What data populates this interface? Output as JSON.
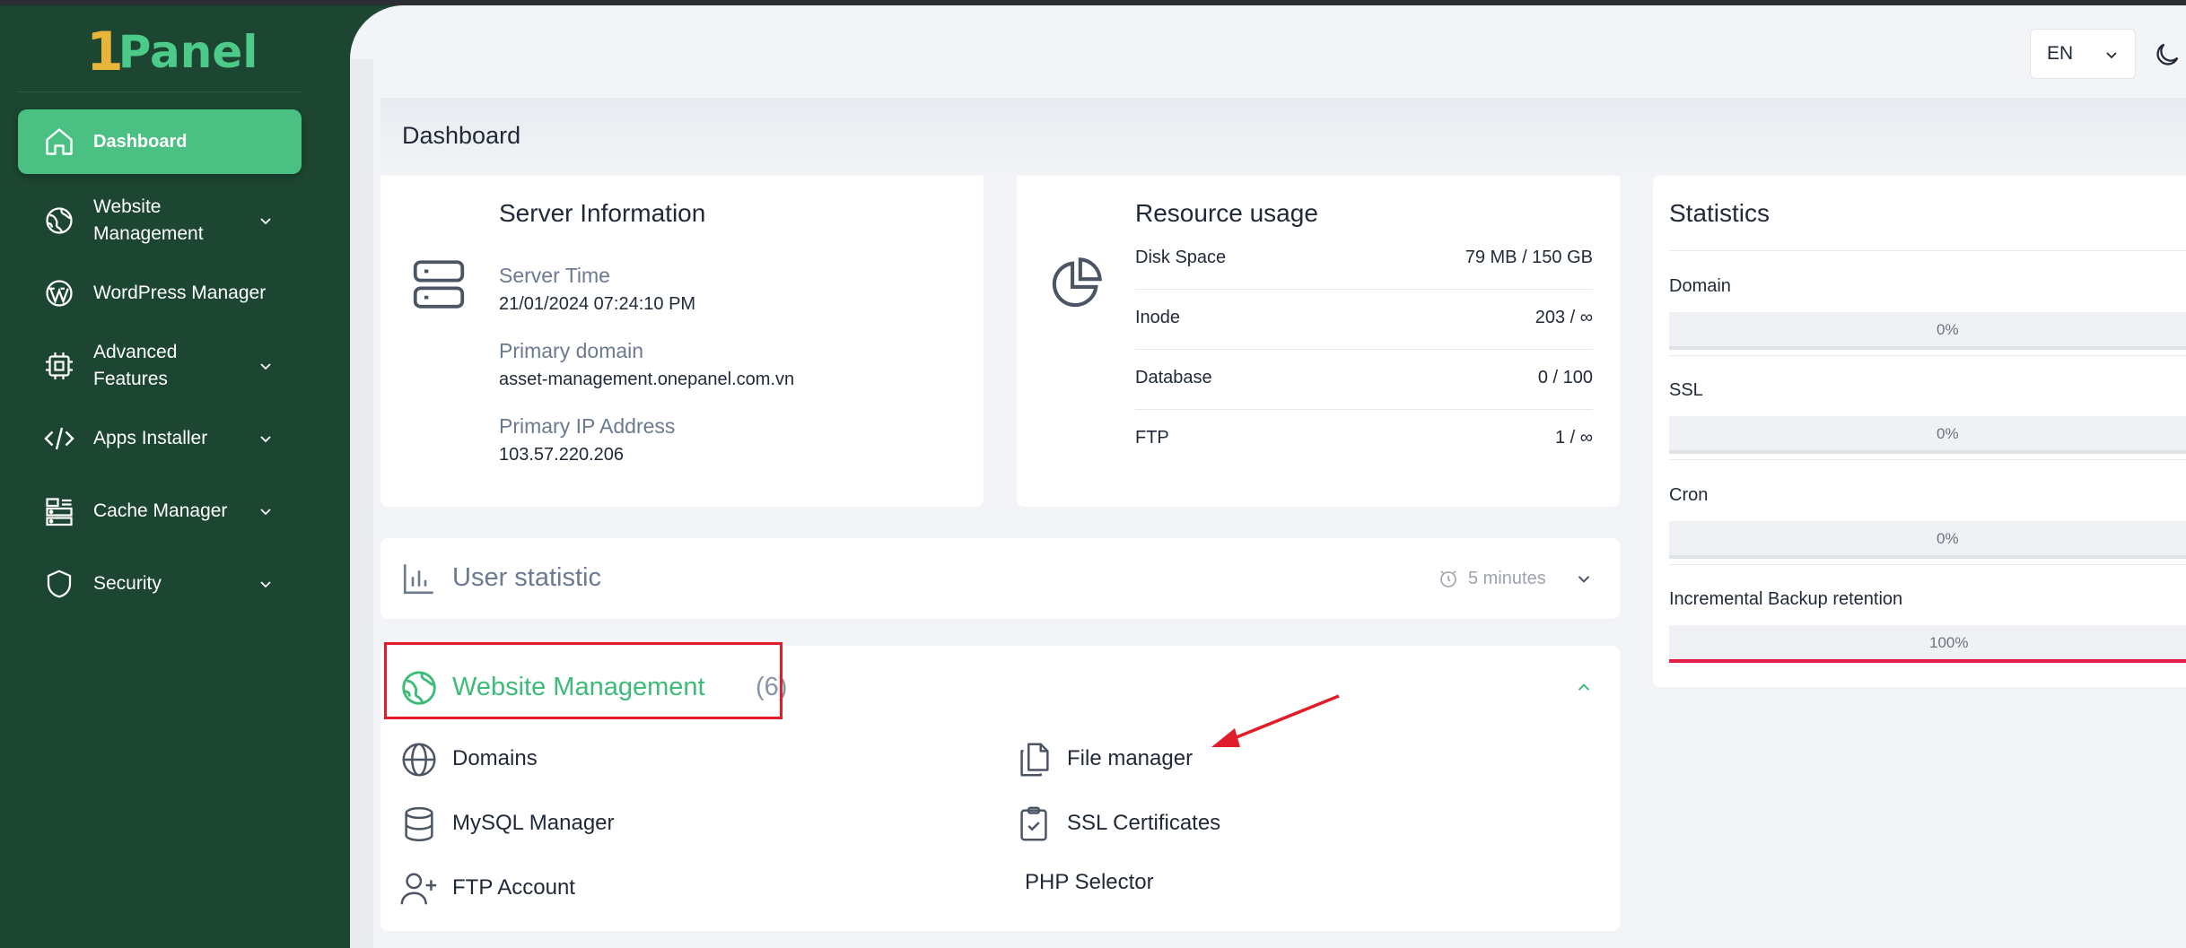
{
  "sidebar": {
    "logo": {
      "one": "1",
      "text": "Panel"
    },
    "items": [
      {
        "label": "Dashboard",
        "icon": "home-icon"
      },
      {
        "label": "Website\nManagement",
        "icon": "globe-network-icon"
      },
      {
        "label": "WordPress Manager",
        "icon": "wordpress-icon"
      },
      {
        "label": "Advanced\nFeatures",
        "icon": "chip-icon"
      },
      {
        "label": "Apps Installer",
        "icon": "code-icon"
      },
      {
        "label": "Cache Manager",
        "icon": "server-stack-icon"
      },
      {
        "label": "Security",
        "icon": "shield-icon"
      }
    ]
  },
  "header": {
    "language": "EN",
    "page_title": "Dashboard"
  },
  "server_info": {
    "title": "Server Information",
    "server_time_label": "Server Time",
    "server_time": "21/01/2024 07:24:10 PM",
    "primary_domain_label": "Primary domain",
    "primary_domain": "asset-management.onepanel.com.vn",
    "primary_ip_label": "Primary IP Address",
    "primary_ip": "103.57.220.206"
  },
  "resource_usage": {
    "title": "Resource usage",
    "rows": [
      {
        "label": "Disk Space",
        "value": "79 MB / 150 GB"
      },
      {
        "label": "Inode",
        "value": "203 / ∞"
      },
      {
        "label": "Database",
        "value": "0 / 100"
      },
      {
        "label": "FTP",
        "value": "1 / ∞"
      }
    ]
  },
  "statistics": {
    "title": "Statistics",
    "items": [
      {
        "label": "Domain",
        "percent": "0%"
      },
      {
        "label": "SSL",
        "percent": "0%"
      },
      {
        "label": "Cron",
        "percent": "0%"
      },
      {
        "label": "Incremental Backup retention",
        "percent": "100%"
      }
    ]
  },
  "user_statistic": {
    "title": "User statistic",
    "interval": "5 minutes"
  },
  "website_management": {
    "title": "Website Management",
    "count": "(6)",
    "items": [
      {
        "label": "Domains",
        "icon": "globe-icon"
      },
      {
        "label": "File manager",
        "icon": "files-icon"
      },
      {
        "label": "MySQL Manager",
        "icon": "database-icon"
      },
      {
        "label": "SSL Certificates",
        "icon": "clipboard-check-icon"
      },
      {
        "label": "FTP Account",
        "icon": "user-plus-icon"
      },
      {
        "label": "PHP Selector",
        "icon": ""
      }
    ]
  },
  "colors": {
    "sidebar_bg": "#1c4631",
    "accent": "#4ac182",
    "highlight": "#e11d2a"
  }
}
